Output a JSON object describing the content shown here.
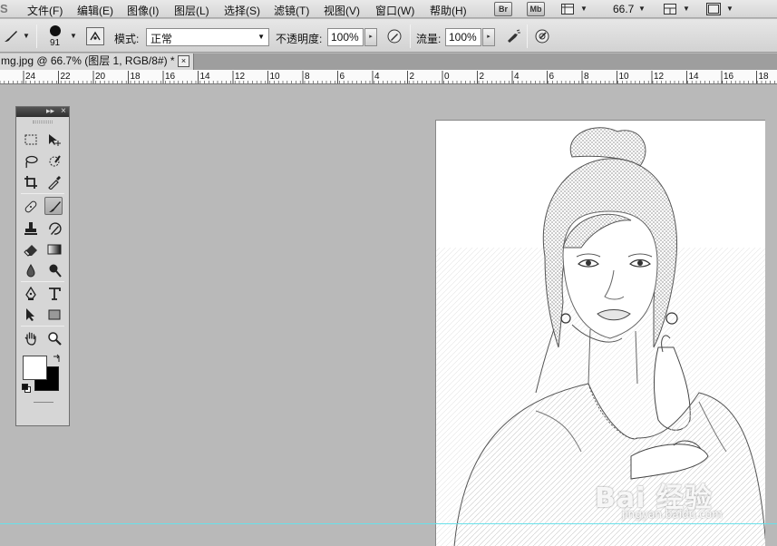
{
  "menubar": {
    "logo": "S",
    "items": [
      "文件(F)",
      "编辑(E)",
      "图像(I)",
      "图层(L)",
      "选择(S)",
      "滤镜(T)",
      "视图(V)",
      "窗口(W)",
      "帮助(H)"
    ],
    "bridge_button": "Br",
    "mini_bridge_button": "Mb",
    "zoom_value": "66.7"
  },
  "options": {
    "brush_size": "91",
    "mode_label": "模式:",
    "mode_value": "正常",
    "opacity_label": "不透明度:",
    "opacity_value": "100%",
    "flow_label": "流量:",
    "flow_value": "100%"
  },
  "document": {
    "tab_title": "mg.jpg @ 66.7% (图层 1, RGB/8#) *",
    "close_glyph": "×"
  },
  "ruler": {
    "labels": [
      "24",
      "22",
      "20",
      "18",
      "16",
      "14",
      "12",
      "10",
      "8",
      "6",
      "4",
      "2",
      "0",
      "2",
      "4",
      "6",
      "8",
      "10",
      "12",
      "14",
      "16",
      "18"
    ]
  },
  "toolbox": {
    "header_collapse": "▸▸",
    "header_close": "×",
    "foreground_color": "#ffffff",
    "background_color": "#000000"
  },
  "watermark": {
    "brand": "Bai 经验",
    "url": "jingyan.baidu.com"
  },
  "colors": {
    "workspace": "#b9b9b9",
    "guide": "#69e0ea"
  }
}
